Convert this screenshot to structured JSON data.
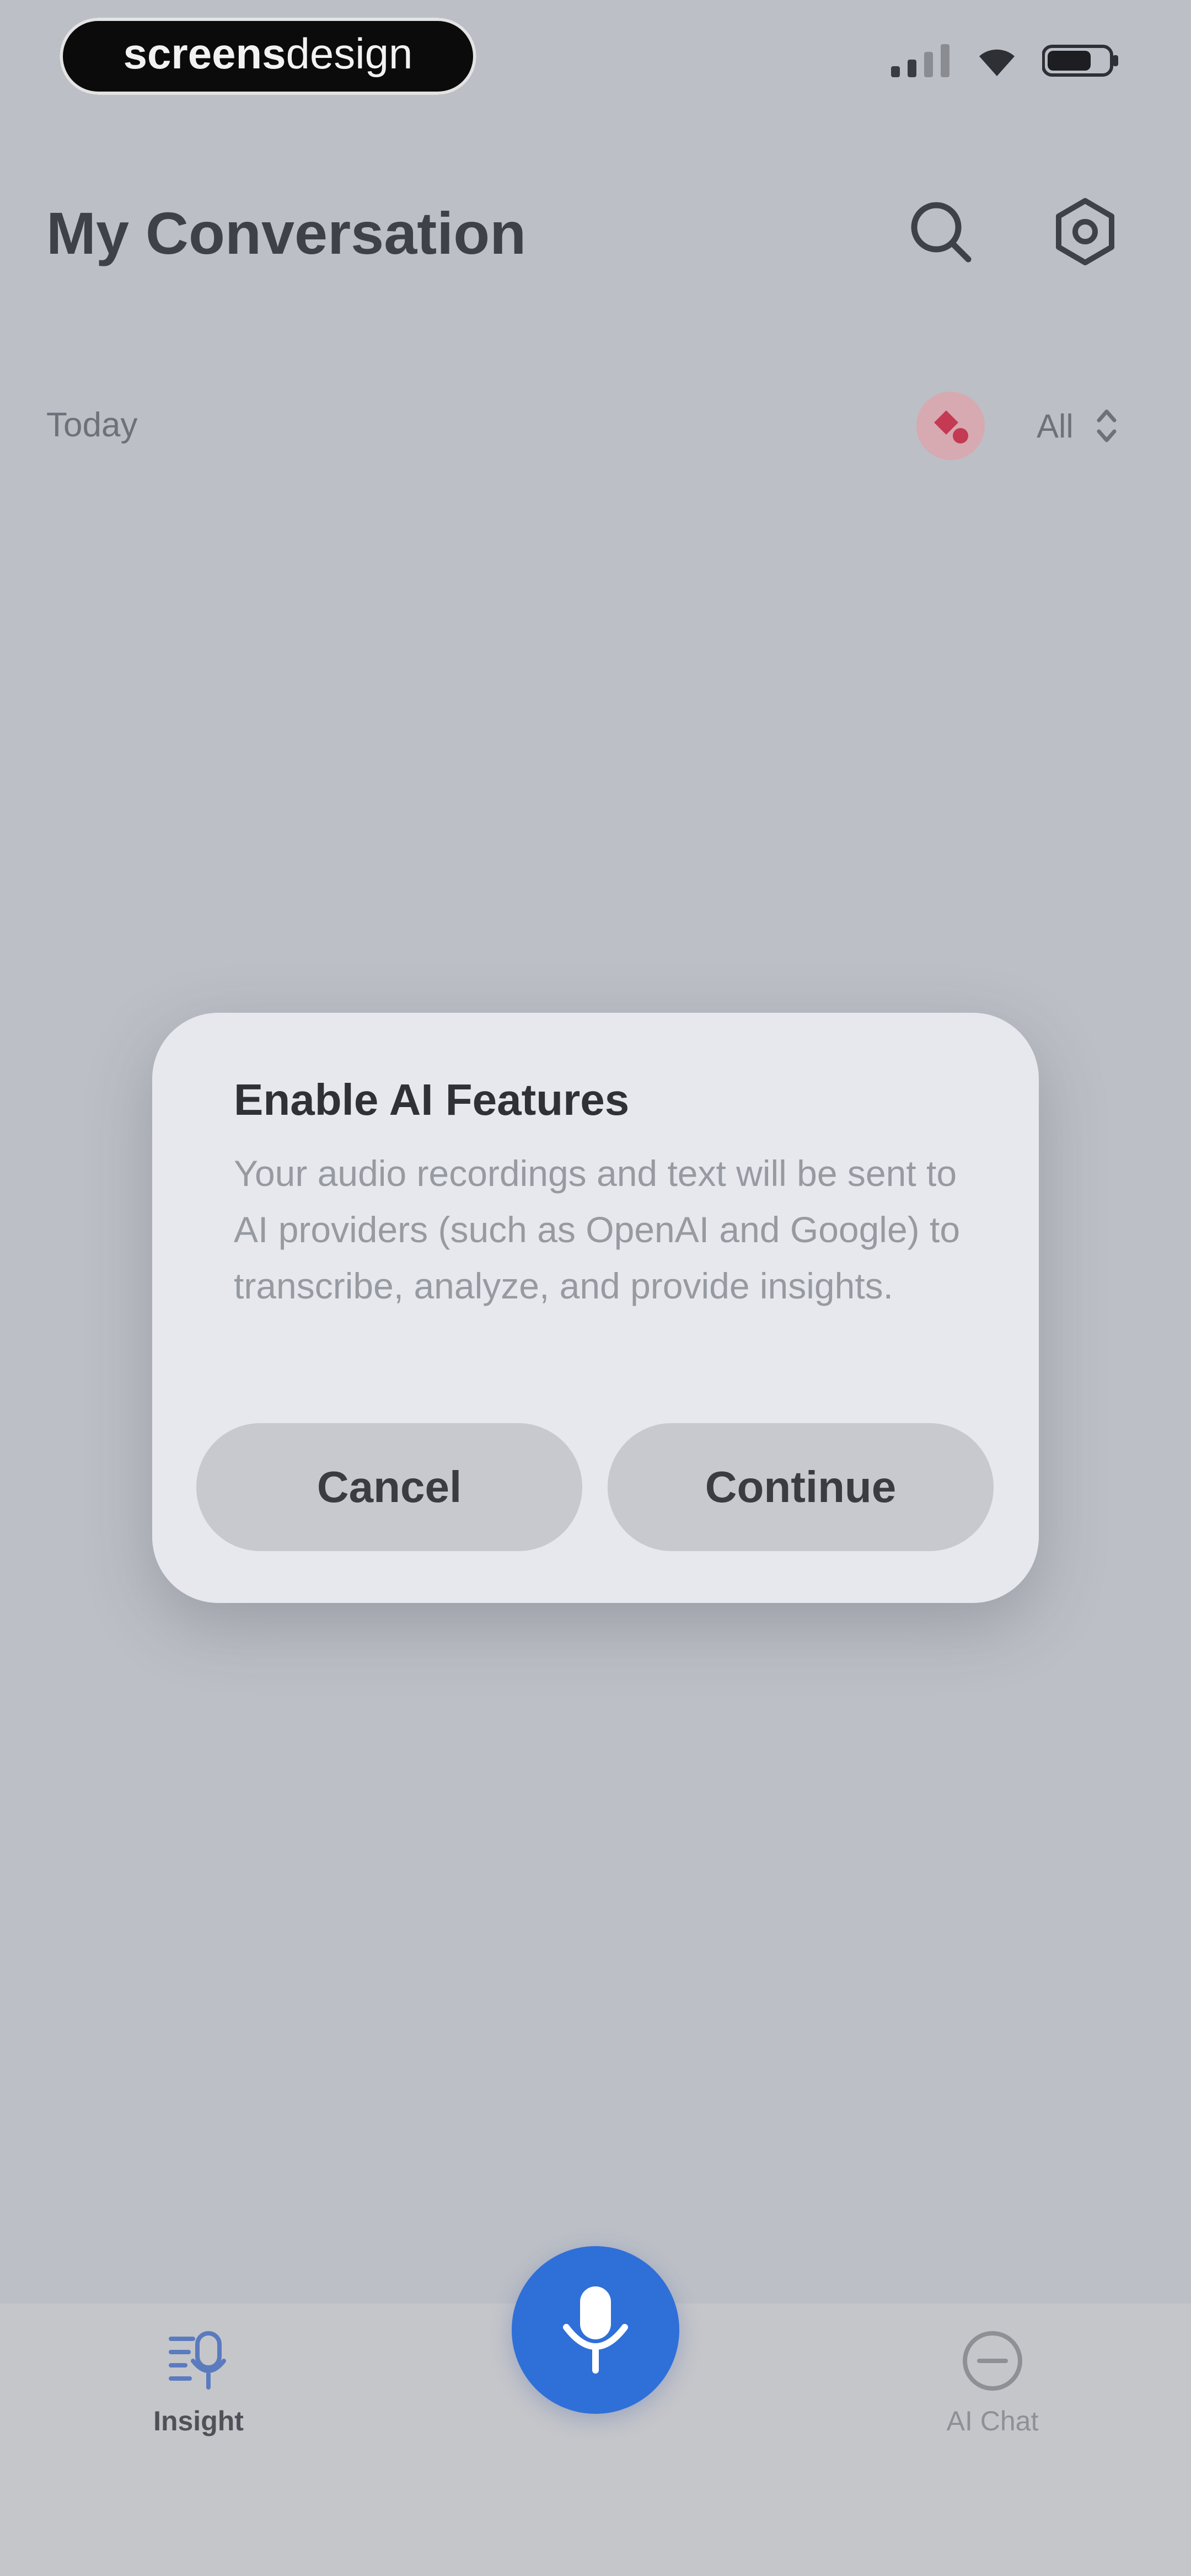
{
  "status_bar": {
    "brand_text": "screensdesign",
    "signal_icon": "signal-icon",
    "wifi_icon": "wifi-icon",
    "battery_icon": "battery-icon"
  },
  "header": {
    "title": "My Conversation",
    "search_icon": "search-icon",
    "settings_icon": "gear-icon"
  },
  "filter_row": {
    "section_label": "Today",
    "filter_value": "All",
    "record_badge_icon": "record-badge-icon"
  },
  "dialog": {
    "title": "Enable AI Features",
    "body": "Your audio recordings and text will be sent to AI providers (such as OpenAI and Google) to transcribe, analyze, and provide insights.",
    "cancel_label": "Cancel",
    "continue_label": "Continue"
  },
  "tabbar": {
    "insight_label": "Insight",
    "aichat_label": "AI Chat",
    "mic_icon": "microphone-icon"
  },
  "colors": {
    "accent": "#2F6FD8",
    "background": "#BCBFC6",
    "dialog": "#E6E8EE"
  }
}
